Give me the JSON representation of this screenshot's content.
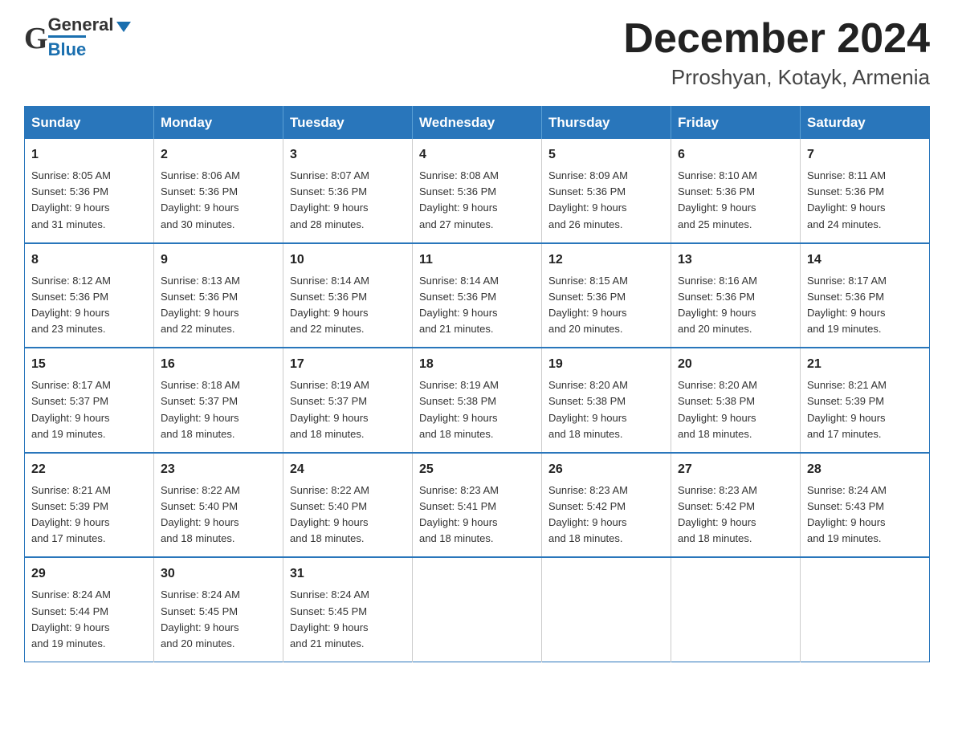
{
  "header": {
    "logo_general": "General",
    "logo_blue": "Blue",
    "month_title": "December 2024",
    "location": "Prroshyan, Kotayk, Armenia"
  },
  "days_of_week": [
    "Sunday",
    "Monday",
    "Tuesday",
    "Wednesday",
    "Thursday",
    "Friday",
    "Saturday"
  ],
  "weeks": [
    [
      {
        "day": "1",
        "sunrise": "8:05 AM",
        "sunset": "5:36 PM",
        "daylight": "9 hours and 31 minutes."
      },
      {
        "day": "2",
        "sunrise": "8:06 AM",
        "sunset": "5:36 PM",
        "daylight": "9 hours and 30 minutes."
      },
      {
        "day": "3",
        "sunrise": "8:07 AM",
        "sunset": "5:36 PM",
        "daylight": "9 hours and 28 minutes."
      },
      {
        "day": "4",
        "sunrise": "8:08 AM",
        "sunset": "5:36 PM",
        "daylight": "9 hours and 27 minutes."
      },
      {
        "day": "5",
        "sunrise": "8:09 AM",
        "sunset": "5:36 PM",
        "daylight": "9 hours and 26 minutes."
      },
      {
        "day": "6",
        "sunrise": "8:10 AM",
        "sunset": "5:36 PM",
        "daylight": "9 hours and 25 minutes."
      },
      {
        "day": "7",
        "sunrise": "8:11 AM",
        "sunset": "5:36 PM",
        "daylight": "9 hours and 24 minutes."
      }
    ],
    [
      {
        "day": "8",
        "sunrise": "8:12 AM",
        "sunset": "5:36 PM",
        "daylight": "9 hours and 23 minutes."
      },
      {
        "day": "9",
        "sunrise": "8:13 AM",
        "sunset": "5:36 PM",
        "daylight": "9 hours and 22 minutes."
      },
      {
        "day": "10",
        "sunrise": "8:14 AM",
        "sunset": "5:36 PM",
        "daylight": "9 hours and 22 minutes."
      },
      {
        "day": "11",
        "sunrise": "8:14 AM",
        "sunset": "5:36 PM",
        "daylight": "9 hours and 21 minutes."
      },
      {
        "day": "12",
        "sunrise": "8:15 AM",
        "sunset": "5:36 PM",
        "daylight": "9 hours and 20 minutes."
      },
      {
        "day": "13",
        "sunrise": "8:16 AM",
        "sunset": "5:36 PM",
        "daylight": "9 hours and 20 minutes."
      },
      {
        "day": "14",
        "sunrise": "8:17 AM",
        "sunset": "5:36 PM",
        "daylight": "9 hours and 19 minutes."
      }
    ],
    [
      {
        "day": "15",
        "sunrise": "8:17 AM",
        "sunset": "5:37 PM",
        "daylight": "9 hours and 19 minutes."
      },
      {
        "day": "16",
        "sunrise": "8:18 AM",
        "sunset": "5:37 PM",
        "daylight": "9 hours and 18 minutes."
      },
      {
        "day": "17",
        "sunrise": "8:19 AM",
        "sunset": "5:37 PM",
        "daylight": "9 hours and 18 minutes."
      },
      {
        "day": "18",
        "sunrise": "8:19 AM",
        "sunset": "5:38 PM",
        "daylight": "9 hours and 18 minutes."
      },
      {
        "day": "19",
        "sunrise": "8:20 AM",
        "sunset": "5:38 PM",
        "daylight": "9 hours and 18 minutes."
      },
      {
        "day": "20",
        "sunrise": "8:20 AM",
        "sunset": "5:38 PM",
        "daylight": "9 hours and 18 minutes."
      },
      {
        "day": "21",
        "sunrise": "8:21 AM",
        "sunset": "5:39 PM",
        "daylight": "9 hours and 17 minutes."
      }
    ],
    [
      {
        "day": "22",
        "sunrise": "8:21 AM",
        "sunset": "5:39 PM",
        "daylight": "9 hours and 17 minutes."
      },
      {
        "day": "23",
        "sunrise": "8:22 AM",
        "sunset": "5:40 PM",
        "daylight": "9 hours and 18 minutes."
      },
      {
        "day": "24",
        "sunrise": "8:22 AM",
        "sunset": "5:40 PM",
        "daylight": "9 hours and 18 minutes."
      },
      {
        "day": "25",
        "sunrise": "8:23 AM",
        "sunset": "5:41 PM",
        "daylight": "9 hours and 18 minutes."
      },
      {
        "day": "26",
        "sunrise": "8:23 AM",
        "sunset": "5:42 PM",
        "daylight": "9 hours and 18 minutes."
      },
      {
        "day": "27",
        "sunrise": "8:23 AM",
        "sunset": "5:42 PM",
        "daylight": "9 hours and 18 minutes."
      },
      {
        "day": "28",
        "sunrise": "8:24 AM",
        "sunset": "5:43 PM",
        "daylight": "9 hours and 19 minutes."
      }
    ],
    [
      {
        "day": "29",
        "sunrise": "8:24 AM",
        "sunset": "5:44 PM",
        "daylight": "9 hours and 19 minutes."
      },
      {
        "day": "30",
        "sunrise": "8:24 AM",
        "sunset": "5:45 PM",
        "daylight": "9 hours and 20 minutes."
      },
      {
        "day": "31",
        "sunrise": "8:24 AM",
        "sunset": "5:45 PM",
        "daylight": "9 hours and 21 minutes."
      },
      null,
      null,
      null,
      null
    ]
  ],
  "cell_labels": {
    "sunrise": "Sunrise:",
    "sunset": "Sunset:",
    "daylight": "Daylight:"
  }
}
